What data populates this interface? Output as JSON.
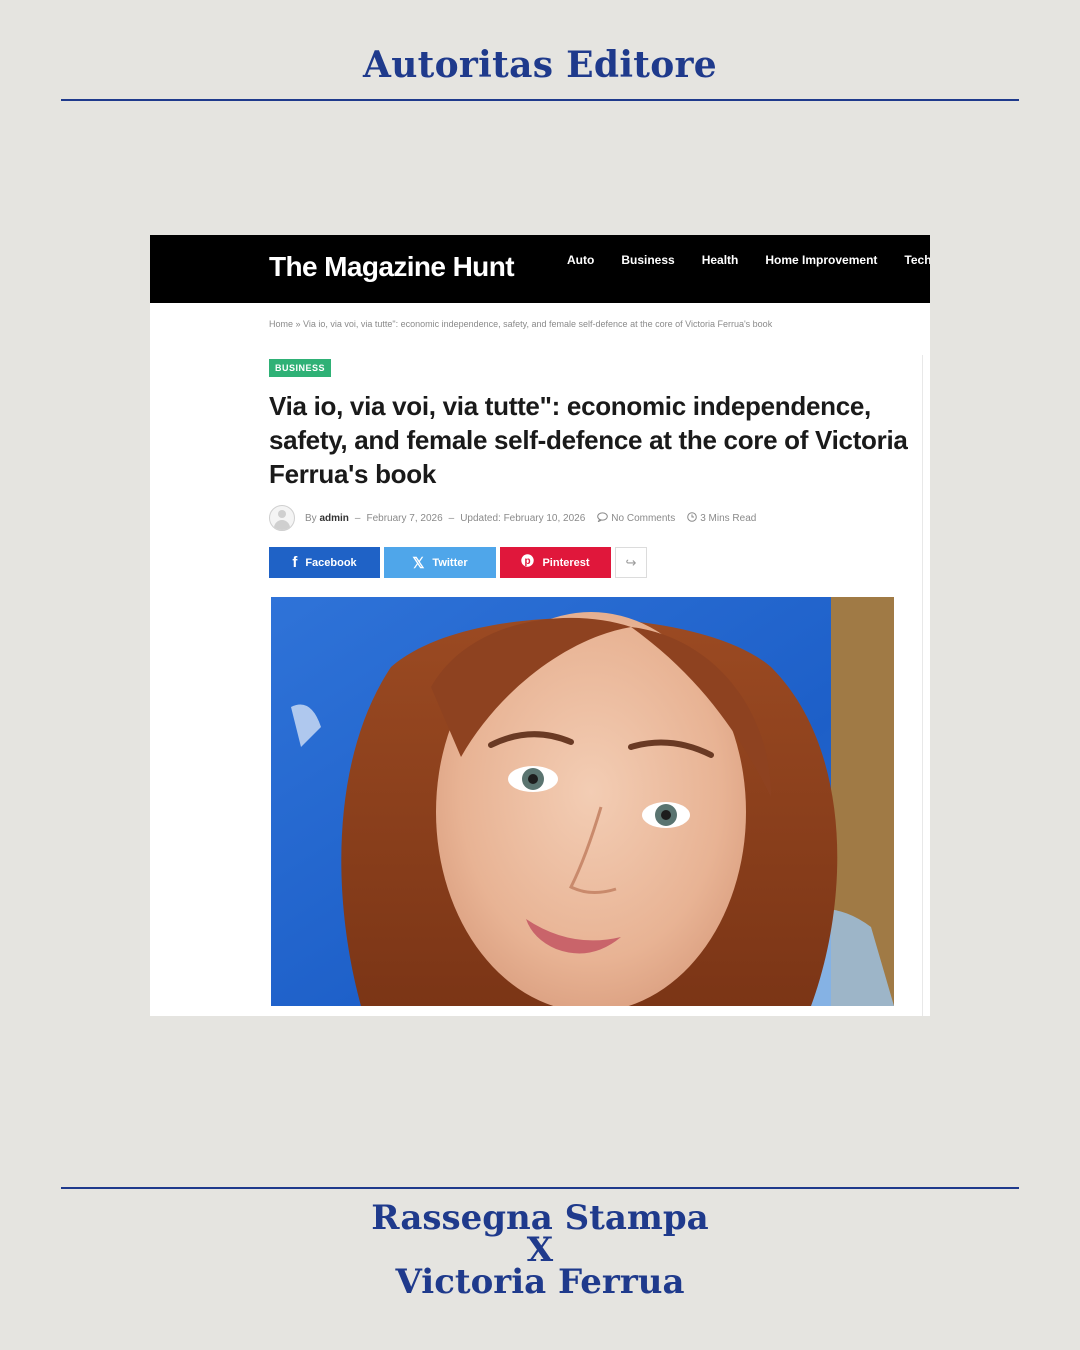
{
  "header": {
    "title": "Autoritas Editore"
  },
  "footer": {
    "line1": "Rassegna Stampa",
    "line2": "X",
    "line3": "Victoria Ferrua"
  },
  "article": {
    "site": {
      "logo": "The Magazine Hunt",
      "nav": [
        "Auto",
        "Business",
        "Health",
        "Home Improvement",
        "Techn"
      ]
    },
    "breadcrumb": "Home » Via io, via voi, via tutte\": economic independence, safety, and female self-defence at the core of Victoria Ferrua's book",
    "category": "BUSINESS",
    "headline": "Via io, via voi, via tutte\": economic independence, safety, and female self-defence at the core of Victoria Ferrua's book",
    "meta": {
      "by": "By",
      "author": "admin",
      "published": "February 7, 2026",
      "updated_label": "Updated:",
      "updated": "February 10, 2026",
      "comments": "No Comments",
      "read_time": "3 Mins Read"
    },
    "share": {
      "facebook": "Facebook",
      "twitter": "Twitter",
      "pinterest": "Pinterest"
    },
    "colors": {
      "facebook": "#1f62c6",
      "twitter": "#4fa6ea",
      "pinterest": "#e0173b",
      "badge": "#2fb176",
      "accent": "#1f3a8c"
    }
  }
}
